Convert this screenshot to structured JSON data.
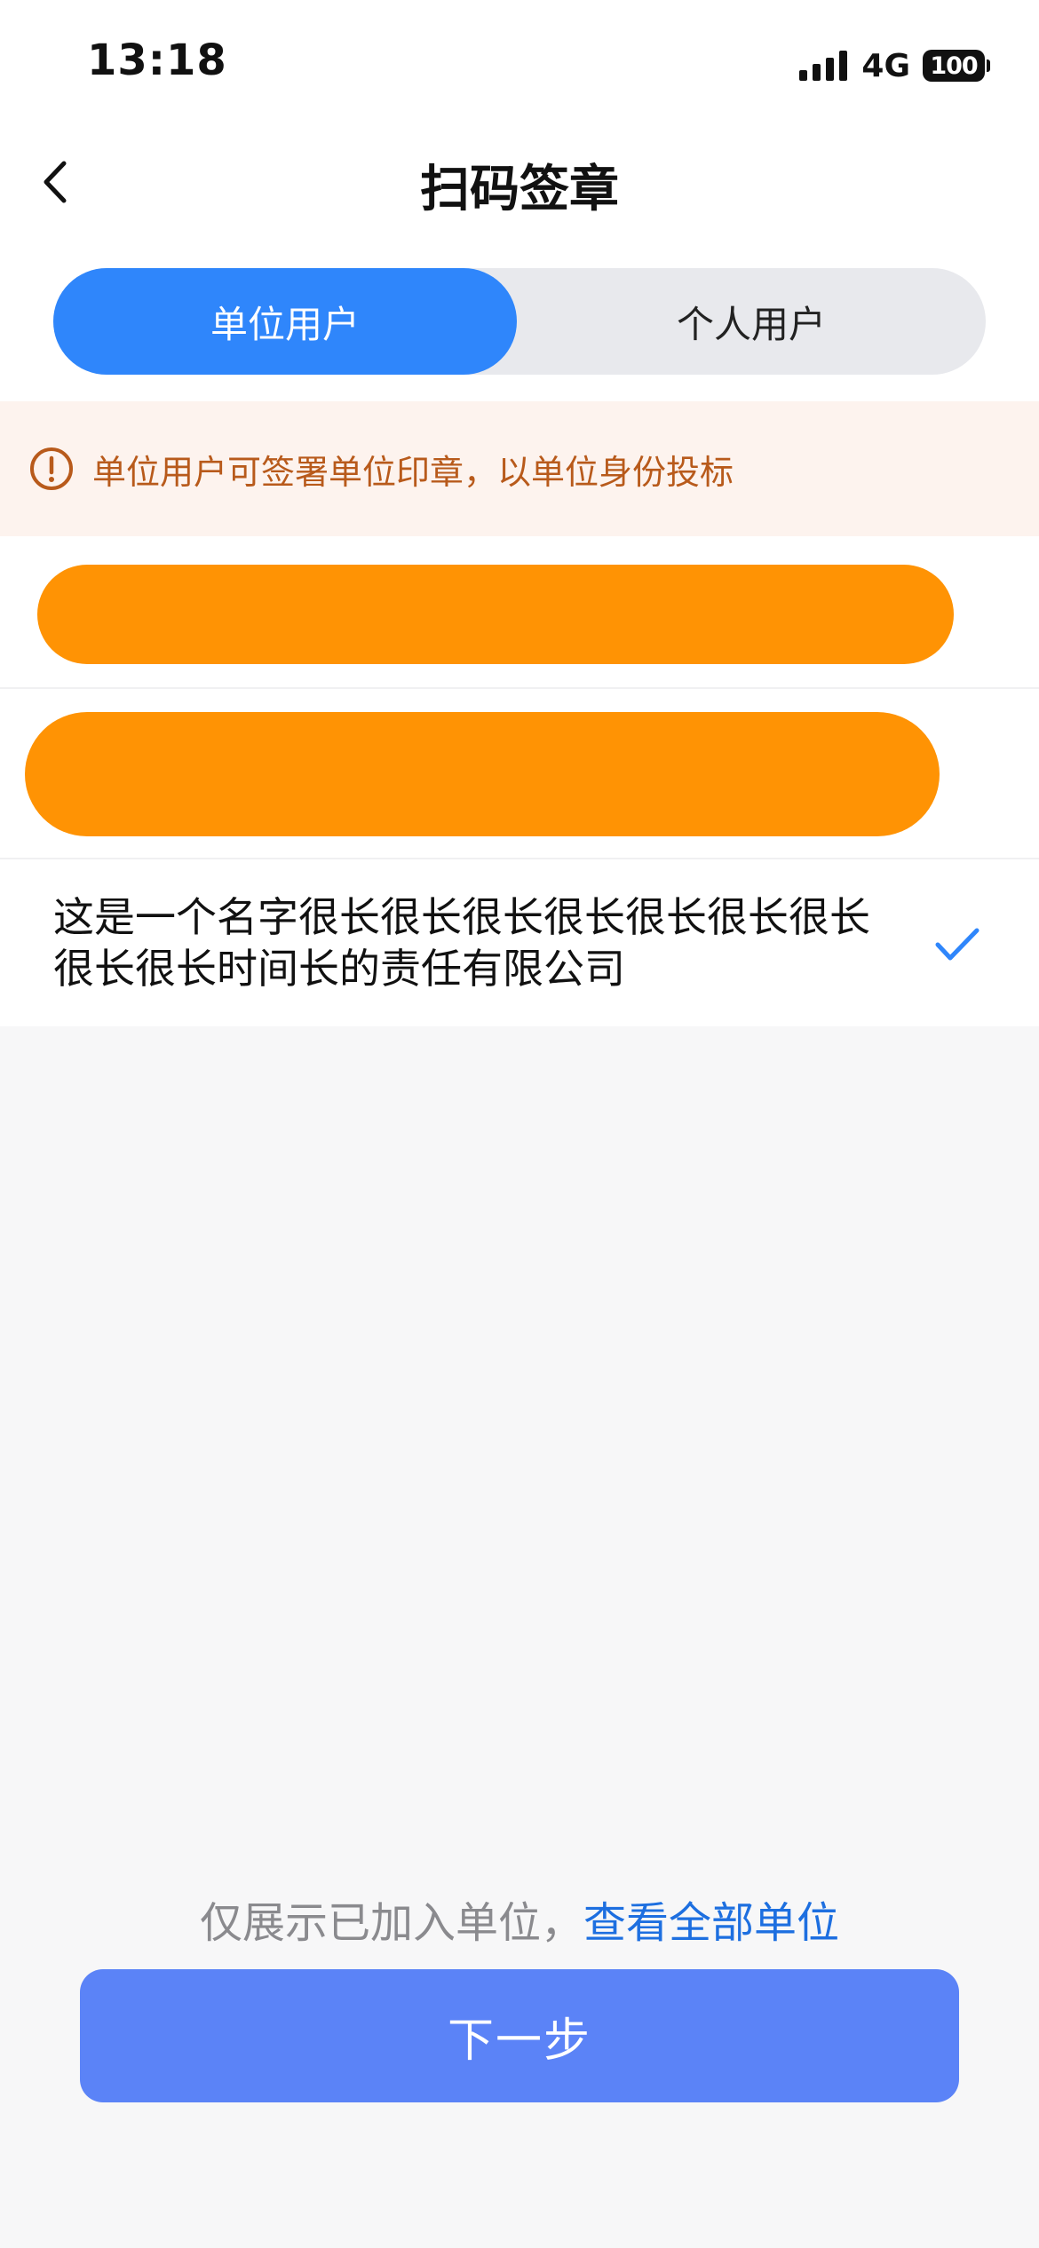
{
  "status_bar": {
    "time": "13:18",
    "network": "4G",
    "battery": "100"
  },
  "nav": {
    "title": "扫码签章"
  },
  "segment": {
    "tabs": [
      {
        "label": "单位用户",
        "active": true
      },
      {
        "label": "个人用户",
        "active": false
      }
    ]
  },
  "notice": {
    "text": "单位用户可签署单位印章，以单位身份投标"
  },
  "list": {
    "selected_company": "这是一个名字很长很长很长很长很长很长很长很长很长时间长的责任有限公司"
  },
  "footer": {
    "hint_prefix": "仅展示已加入单位，",
    "hint_link": "查看全部单位",
    "next_label": "下一步"
  },
  "colors": {
    "accent": "#2f86fb",
    "button": "#5b83f7",
    "notice_text": "#b85a1b",
    "redaction": "#ff9304"
  }
}
